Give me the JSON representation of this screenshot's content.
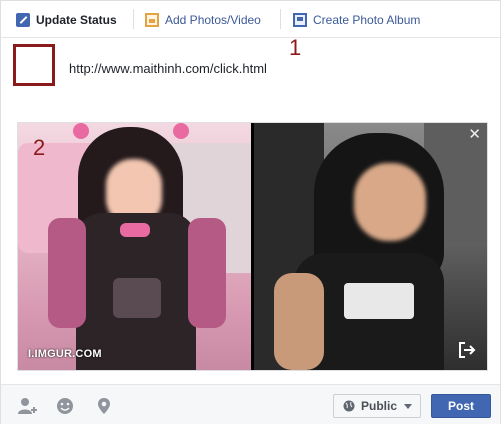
{
  "tabs": [
    {
      "label": "Update Status",
      "icon": "pencil-icon",
      "active": true
    },
    {
      "label": "Add Photos/Video",
      "icon": "photo-icon",
      "active": false
    },
    {
      "label": "Create Photo Album",
      "icon": "album-icon",
      "active": false
    }
  ],
  "annotations": {
    "one": "1",
    "two": "2"
  },
  "composer": {
    "text": "http://www.maithinh.com/click.html"
  },
  "preview": {
    "credit": "I.IMGUR.COM",
    "close_glyph": "✕"
  },
  "footer": {
    "audience_label": "Public",
    "post_label": "Post",
    "icons": [
      "tag-friends-icon",
      "feeling-icon",
      "location-icon"
    ]
  },
  "colors": {
    "brand": "#4267b2",
    "annotation": "#8b1a1a",
    "link": "#3b5998"
  }
}
